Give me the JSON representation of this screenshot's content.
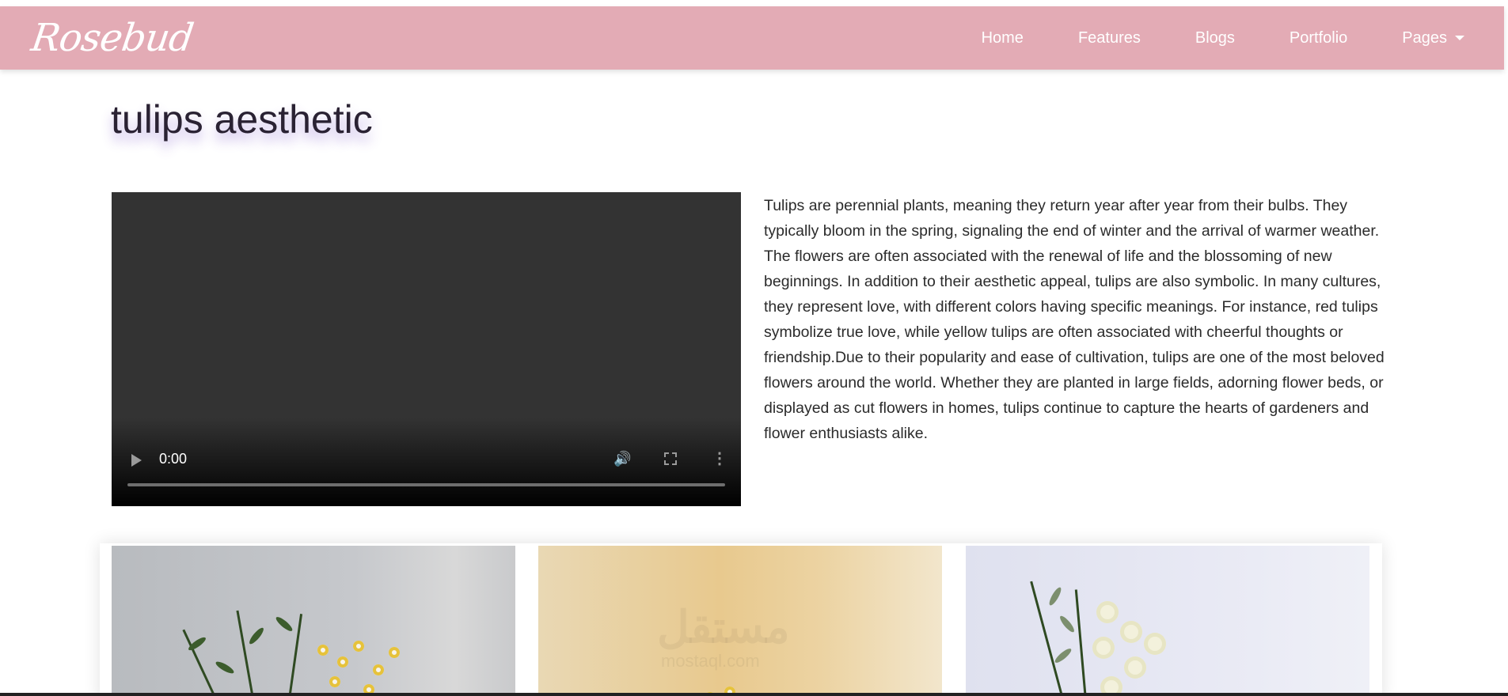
{
  "brand": {
    "name": "Rosebud"
  },
  "nav": {
    "items": [
      {
        "label": "Home"
      },
      {
        "label": "Features"
      },
      {
        "label": "Blogs"
      },
      {
        "label": "Portfolio"
      },
      {
        "label": "Pages"
      }
    ]
  },
  "page": {
    "title": "tulips aesthetic",
    "description": "Tulips are perennial plants, meaning they return year after year from their bulbs. They typically bloom in the spring, signaling the end of winter and the arrival of warmer weather. The flowers are often associated with the renewal of life and the blossoming of new beginnings. In addition to their aesthetic appeal, tulips are also symbolic. In many cultures, they represent love, with different colors having specific meanings. For instance, red tulips symbolize true love, while yellow tulips are often associated with cheerful thoughts or friendship.Due to their popularity and ease of cultivation, tulips are one of the most beloved flowers around the world. Whether they are planted in large fields, adorning flower beds, or displayed as cut flowers in homes, tulips continue to capture the hearts of gardeners and flower enthusiasts alike."
  },
  "video": {
    "time": "0:00",
    "progress": 0
  },
  "gallery": {
    "watermark": "مستقل",
    "watermark_sub": "mostaql.com"
  },
  "colors": {
    "navbar": "#e3abb5",
    "title_glow": "#7850c8"
  },
  "icons": [
    "play-icon",
    "volume-icon",
    "fullscreen-icon",
    "more-vert-icon",
    "chevron-down-icon"
  ]
}
